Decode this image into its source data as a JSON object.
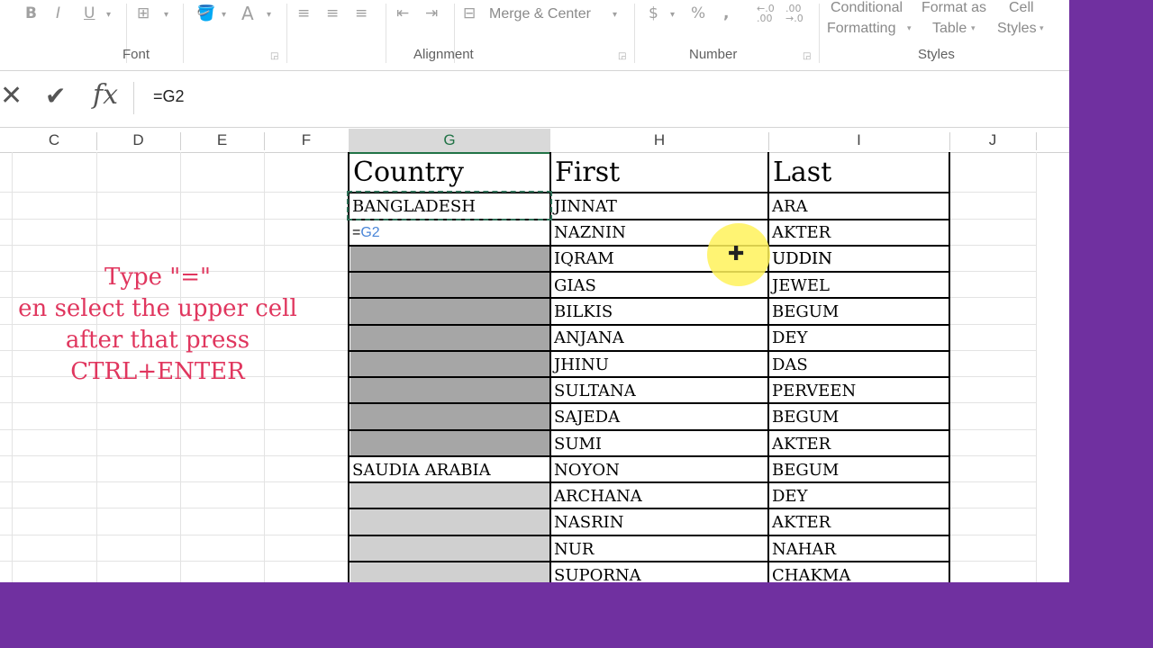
{
  "ribbon": {
    "font_tools": [
      "B",
      "I",
      "U"
    ],
    "alignment_merge": "Merge & Center",
    "number_tools": [
      "$",
      "%",
      ","
    ],
    "styles": {
      "conditional_formatting": [
        "Conditional",
        "Formatting"
      ],
      "format_as_table": [
        "Format as",
        "Table"
      ],
      "cell_styles": [
        "Cell",
        "Styles"
      ]
    },
    "groups": {
      "font": "Font",
      "alignment": "Alignment",
      "number": "Number",
      "styles": "Styles"
    }
  },
  "formula_bar": {
    "cancel": "✕",
    "enter": "✔",
    "fx": "fx",
    "formula": "=G2"
  },
  "columns": [
    "C",
    "D",
    "E",
    "F",
    "G",
    "H",
    "I",
    "J"
  ],
  "selected_column": "G",
  "headers": {
    "country": "Country",
    "first": "First",
    "last": "Last"
  },
  "rows": [
    {
      "country": "BANGLADESH",
      "first": "JINNAT",
      "last": "ARA",
      "fill": "none"
    },
    {
      "country": "=G2",
      "first": "NAZNIN",
      "last": "AKTER",
      "fill": "editing"
    },
    {
      "country": "",
      "first": "IQRAM",
      "last": "UDDIN",
      "fill": "dark"
    },
    {
      "country": "",
      "first": "GIAS",
      "last": "JEWEL",
      "fill": "dark"
    },
    {
      "country": "",
      "first": "BILKIS",
      "last": "BEGUM",
      "fill": "dark"
    },
    {
      "country": "",
      "first": "ANJANA",
      "last": "DEY",
      "fill": "dark"
    },
    {
      "country": "",
      "first": "JHINU",
      "last": "DAS",
      "fill": "dark"
    },
    {
      "country": "",
      "first": "SULTANA",
      "last": "PERVEEN",
      "fill": "dark"
    },
    {
      "country": "",
      "first": "SAJEDA",
      "last": "BEGUM",
      "fill": "dark"
    },
    {
      "country": "",
      "first": "SUMI",
      "last": "AKTER",
      "fill": "dark"
    },
    {
      "country": "SAUDIA ARABIA",
      "first": "NOYON",
      "last": "BEGUM",
      "fill": "none"
    },
    {
      "country": "",
      "first": "ARCHANA",
      "last": "DEY",
      "fill": "light"
    },
    {
      "country": "",
      "first": "NASRIN",
      "last": "AKTER",
      "fill": "light"
    },
    {
      "country": "",
      "first": "NUR",
      "last": "NAHAR",
      "fill": "light"
    },
    {
      "country": "",
      "first": "SUPORNA",
      "last": "CHAKMA",
      "fill": "light"
    }
  ],
  "instruction": [
    "Type \"=\"",
    "en select the upper cell",
    "after that press",
    "CTRL+ENTER"
  ],
  "colors": {
    "accent": "#e0365e",
    "frame": "#7030a0",
    "selected_fill": "#a6a6a6",
    "light_fill": "#d0d0d0",
    "formula_ref": "#4a86d8",
    "cursor_highlight": "#fff25a"
  }
}
